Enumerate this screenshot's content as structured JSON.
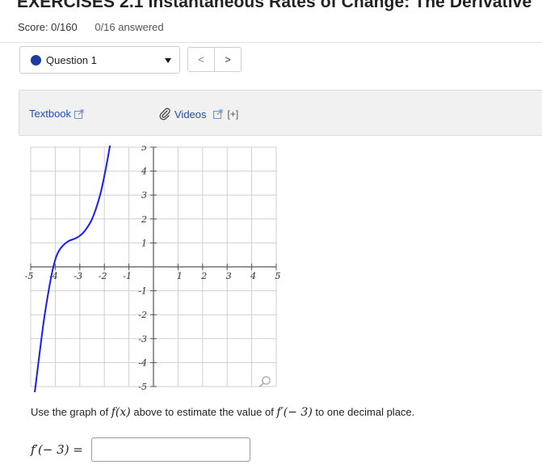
{
  "header": {
    "title": "EXERCISES 2.1 Instantaneous Rates of Change: The Derivative",
    "score": "Score: 0/160",
    "answered": "0/16 answered"
  },
  "question_nav": {
    "selected": "Question 1",
    "prev_label": "<",
    "next_label": ">"
  },
  "help": {
    "textbook": "Textbook",
    "videos": "Videos",
    "expand": "[+]"
  },
  "graph": {
    "x_ticks": [
      "-5",
      "-4",
      "-3",
      "-2",
      "-1",
      "1",
      "2",
      "3",
      "4",
      "5"
    ],
    "y_ticks": [
      "5",
      "4",
      "3",
      "2",
      "1",
      "-1",
      "-2",
      "-3",
      "-4",
      "-5"
    ],
    "curve_color": "#1a1aff",
    "xlim": [
      -5,
      5
    ],
    "ylim": [
      -5,
      5
    ]
  },
  "chart_data": {
    "type": "line",
    "title": "",
    "xlabel": "",
    "ylabel": "",
    "xlim": [
      -5,
      5
    ],
    "ylim": [
      -5,
      5
    ],
    "grid": true,
    "series": [
      {
        "x": [
          -4.9,
          -4.5,
          -4.2,
          -4.0,
          -3.8,
          -3.5,
          -3.2,
          -3.0,
          -2.8,
          -2.5,
          -2.2,
          -2.0,
          -1.8,
          -1.6
        ],
        "y": [
          -5.8,
          -2.5,
          -0.6,
          0.3,
          0.75,
          1.05,
          1.18,
          1.3,
          1.5,
          2.0,
          2.9,
          3.8,
          4.9,
          6.2
        ]
      }
    ]
  },
  "prompt": {
    "before": "Use the graph of ",
    "fx": "f(x)",
    "middle": " above to estimate the value of ",
    "fprime": "f′(− 3)",
    "after": " to one decimal place.",
    "answer_label": "f′(− 3) ="
  },
  "answer": {
    "value": ""
  }
}
